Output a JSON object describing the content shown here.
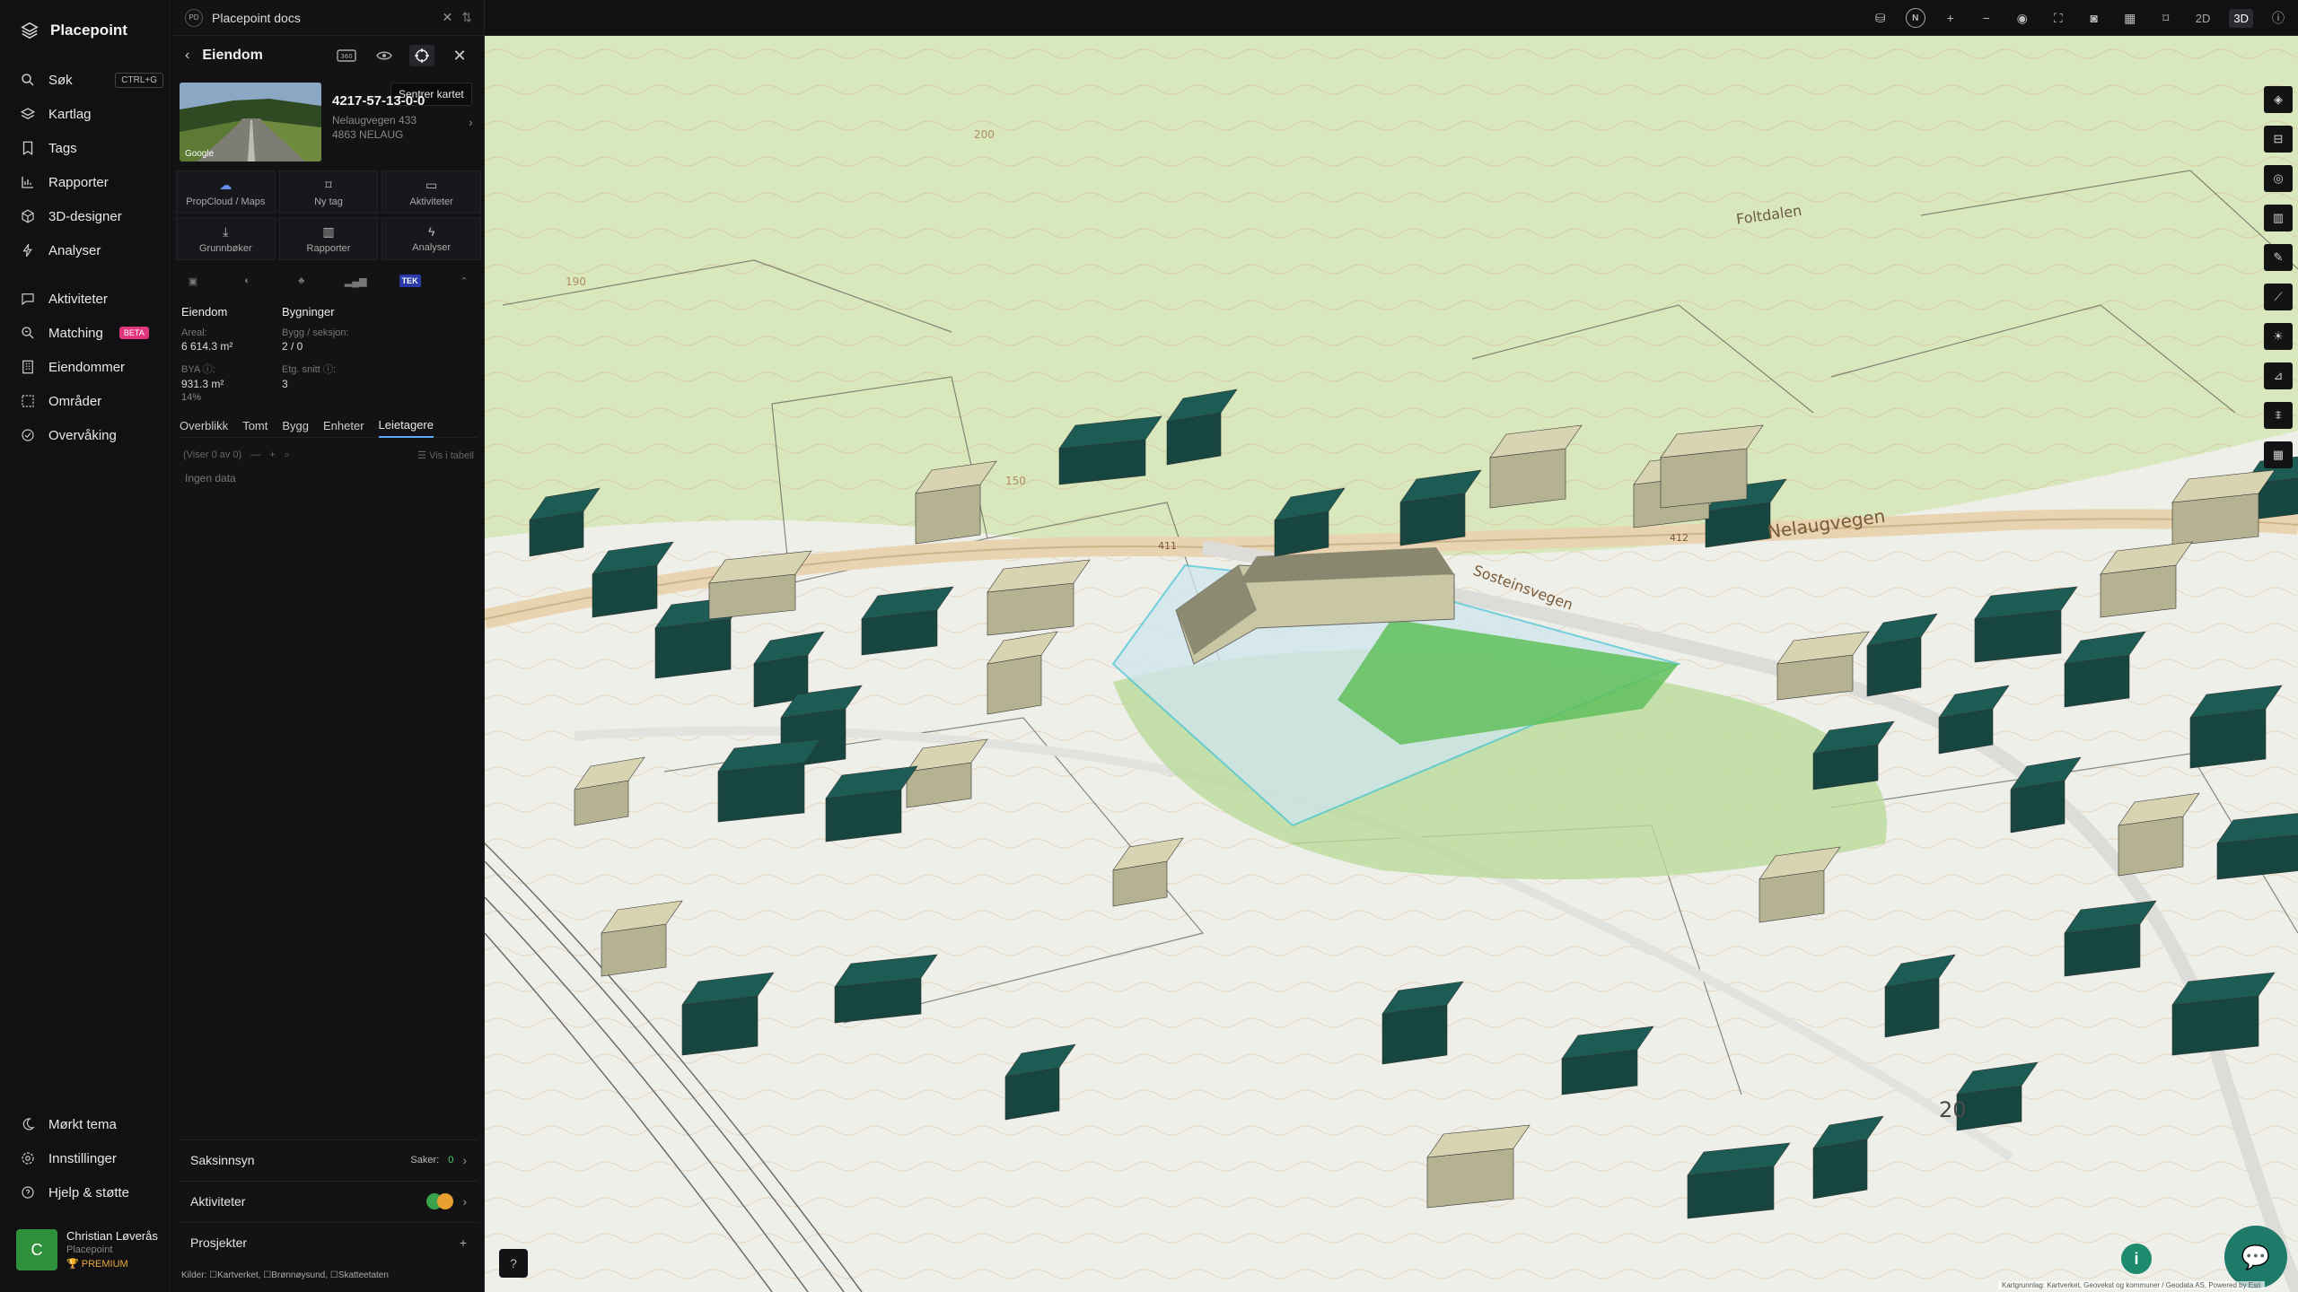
{
  "app": {
    "name": "Placepoint",
    "workspace": "Placepoint docs",
    "workspace_short": "PD"
  },
  "nav": {
    "items": [
      {
        "label": "Søk",
        "icon": "search-icon",
        "shortcut": "CTRL+G"
      },
      {
        "label": "Kartlag",
        "icon": "layers-icon"
      },
      {
        "label": "Tags",
        "icon": "bookmark-icon"
      },
      {
        "label": "Rapporter",
        "icon": "chart-icon"
      },
      {
        "label": "3D-designer",
        "icon": "cube-icon"
      },
      {
        "label": "Analyser",
        "icon": "bolt-icon"
      },
      {
        "label": "Aktiviteter",
        "icon": "chat-icon"
      },
      {
        "label": "Matching",
        "icon": "match-icon",
        "badge": "BETA"
      },
      {
        "label": "Eiendommer",
        "icon": "building-icon"
      },
      {
        "label": "Områder",
        "icon": "area-icon"
      },
      {
        "label": "Overvåking",
        "icon": "monitor-icon"
      }
    ],
    "bottom": [
      {
        "label": "Mørkt tema",
        "icon": "moon-icon"
      },
      {
        "label": "Innstillinger",
        "icon": "gear-icon"
      },
      {
        "label": "Hjelp & støtte",
        "icon": "help-icon"
      }
    ],
    "user": {
      "initial": "C",
      "name": "Christian Løverås",
      "org": "Placepoint",
      "plan": "PREMIUM"
    }
  },
  "panel": {
    "title": "Eiendom",
    "tooltip": "Sentrer kartet",
    "photo_credit": "Google",
    "property_id": "4217-57-13-0-0",
    "address": "Nelaugvegen 433",
    "postal": "4863 NELAUG",
    "actions": [
      {
        "label": "PropCloud / Maps",
        "icon": "cloud-icon"
      },
      {
        "label": "Ny tag",
        "icon": "bookmark-icon"
      },
      {
        "label": "Aktiviteter",
        "icon": "chat-icon"
      },
      {
        "label": "Grunnbøker",
        "icon": "download-icon"
      },
      {
        "label": "Rapporter",
        "icon": "chart-icon"
      },
      {
        "label": "Analyser",
        "icon": "bolt-icon"
      }
    ],
    "tek_label": "TEK",
    "stats": {
      "col1_head": "Eiendom",
      "col2_head": "Bygninger",
      "areal_label": "Areal:",
      "areal_value": "6 614.3 m²",
      "bygg_label": "Bygg / seksjon:",
      "bygg_value": "2 / 0",
      "bya_label": "BYA ⓘ:",
      "bya_value": "931.3 m²",
      "bya_pct": "14%",
      "etg_label": "Etg. snitt ⓘ:",
      "etg_value": "3"
    },
    "tabs": [
      "Overblikk",
      "Tomt",
      "Bygg",
      "Enheter",
      "Leietagere"
    ],
    "active_tab": "Leietagere",
    "list_count": "(Viser 0 av 0)",
    "list_view": "Vis i tabell",
    "empty_text": "Ingen data",
    "sections": [
      {
        "label": "Saksinnsyn",
        "meta": "Saker:",
        "count": "0"
      },
      {
        "label": "Aktiviteter"
      },
      {
        "label": "Prosjekter"
      }
    ],
    "sources_label": "Kilder:",
    "sources": [
      "Kartverket,",
      "Brønnøysund,",
      "Skatteetaten"
    ]
  },
  "topbar": {
    "mode_2d": "2D",
    "mode_3d": "3D",
    "north": "N"
  },
  "map": {
    "labels": {
      "road1": "Nelaugvegen",
      "road2": "Sosteinsvegen",
      "place": "Foltdalen",
      "num1": "20",
      "c200": "200",
      "c190": "190",
      "c150": "150",
      "road_num": "412",
      "road_num2": "411"
    },
    "attribution": "Kartgrunnlag: Kartverket, Geovekst og kommuner / Geodata AS, Powered by Esri"
  },
  "colors": {
    "building": "#1d5c55",
    "building_beige": "#d8d4b2",
    "map_bg": "#eeefea",
    "forest": "#d7e6b8",
    "selection": "#49c5d6",
    "accent": "#5fa8ff"
  }
}
